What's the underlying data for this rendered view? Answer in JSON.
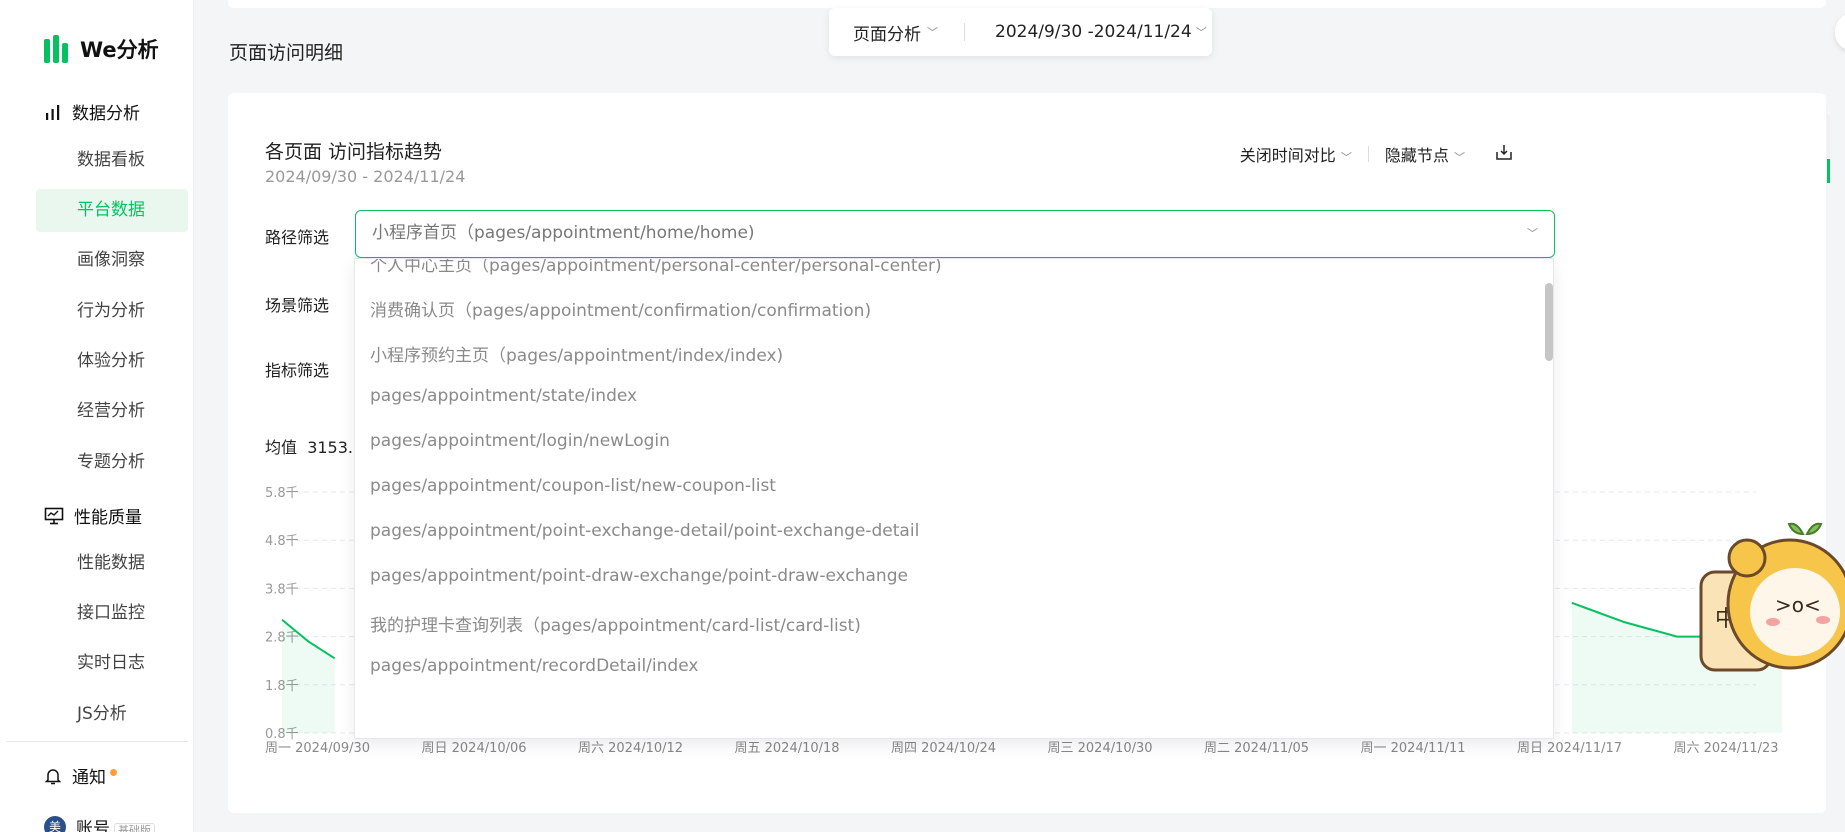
{
  "app": {
    "logo_text": "We分析"
  },
  "sidebar": {
    "group_data": "数据分析",
    "items_data": [
      {
        "label": "数据看板",
        "active": false
      },
      {
        "label": "平台数据",
        "active": true
      },
      {
        "label": "画像洞察",
        "active": false
      },
      {
        "label": "行为分析",
        "active": false
      },
      {
        "label": "体验分析",
        "active": false
      },
      {
        "label": "经营分析",
        "active": false
      },
      {
        "label": "专题分析",
        "active": false
      }
    ],
    "group_perf": "性能质量",
    "items_perf": [
      {
        "label": "性能数据"
      },
      {
        "label": "接口监控"
      },
      {
        "label": "实时日志"
      },
      {
        "label": "JS分析"
      }
    ],
    "notify": "通知",
    "account": "账号",
    "account_avatar": "美",
    "plan": "基础版"
  },
  "topbar": {
    "mode": "页面分析",
    "date_range": "2024/9/30 -2024/11/24"
  },
  "page": {
    "title": "页面访问明细"
  },
  "card": {
    "title": "各页面 访问指标趋势",
    "subtitle": "2024/09/30 - 2024/11/24",
    "toggle_compare": "关闭时间对比",
    "toggle_nodes": "隐藏节点",
    "filters": {
      "path_label": "路径筛选",
      "scene_label": "场景筛选",
      "metric_label": "指标筛选",
      "path_value": "小程序首页（pages/appointment/home/home)"
    },
    "avg_label": "均值",
    "avg_value": "3153.0"
  },
  "dropdown": {
    "options": [
      "个人中心主页（pages/appointment/personal-center/personal-center)",
      "消费确认页（pages/appointment/confirmation/confirmation)",
      "小程序预约主页（pages/appointment/index/index)",
      "pages/appointment/state/index",
      "pages/appointment/login/newLogin",
      "pages/appointment/coupon-list/new-coupon-list",
      "pages/appointment/point-exchange-detail/point-exchange-detail",
      "pages/appointment/point-draw-exchange/point-draw-exchange",
      "我的护理卡查询列表（pages/appointment/card-list/card-list)",
      "pages/appointment/recordDetail/index"
    ]
  },
  "chart_data": {
    "type": "area",
    "y_ticks": [
      "0.8千",
      "1.8千",
      "2.8千",
      "3.8千",
      "4.8千",
      "5.8千"
    ],
    "x_tick_labels": [
      "周一 2024/09/30",
      "周日 2024/10/06",
      "周六 2024/10/12",
      "周五 2024/10/18",
      "周四 2024/10/24",
      "周三 2024/10/30",
      "周二 2024/11/05",
      "周一 2024/11/11",
      "周日 2024/11/17",
      "周六 2024/11/23"
    ],
    "ylim": [
      800,
      5800
    ],
    "grid": true,
    "series": [
      {
        "color": "#07c160",
        "visible_points": [
          {
            "x": 0,
            "y": 3150
          },
          {
            "x": 1,
            "y": 2700
          },
          {
            "x": 2,
            "y": 2350
          },
          {
            "x": 49,
            "y": 3500
          },
          {
            "x": 50,
            "y": 3300
          },
          {
            "x": 51,
            "y": 3100
          },
          {
            "x": 52,
            "y": 2950
          },
          {
            "x": 53,
            "y": 2800
          },
          {
            "x": 54,
            "y": 2800
          },
          {
            "x": 55,
            "y": 2850
          },
          {
            "x": 56,
            "y": 3150
          },
          {
            "x": 57,
            "y": 3350
          }
        ]
      }
    ]
  }
}
